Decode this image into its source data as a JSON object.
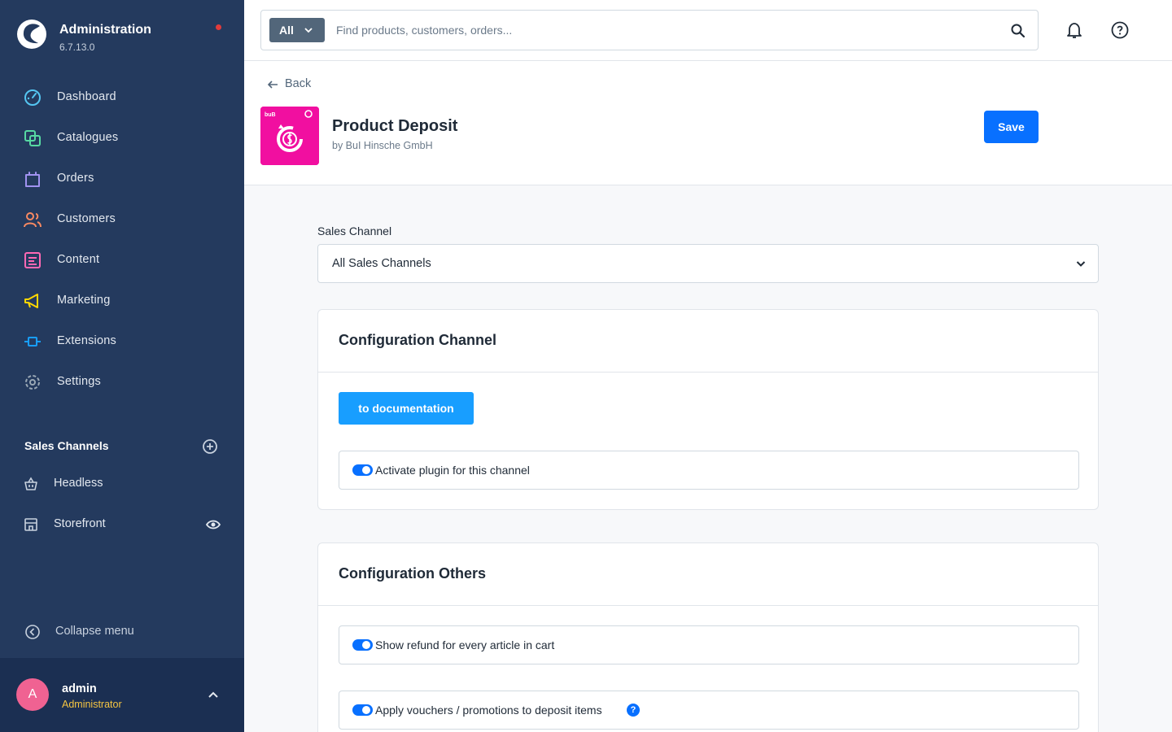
{
  "app": {
    "title": "Administration",
    "version": "6.7.13.0"
  },
  "nav": {
    "items": [
      {
        "label": "Dashboard",
        "icon": "dashboard-icon",
        "color": "#55c6f2"
      },
      {
        "label": "Catalogues",
        "icon": "catalogue-icon",
        "color": "#57d9a3"
      },
      {
        "label": "Orders",
        "icon": "orders-icon",
        "color": "#a092f0"
      },
      {
        "label": "Customers",
        "icon": "customers-icon",
        "color": "#f88962"
      },
      {
        "label": "Content",
        "icon": "content-icon",
        "color": "#ff68b4"
      },
      {
        "label": "Marketing",
        "icon": "marketing-icon",
        "color": "#ffd700"
      },
      {
        "label": "Extensions",
        "icon": "extensions-icon",
        "color": "#189eff"
      },
      {
        "label": "Settings",
        "icon": "settings-icon",
        "color": "#9aa8b5"
      }
    ]
  },
  "sales_channels": {
    "title": "Sales Channels",
    "items": [
      {
        "label": "Headless",
        "icon": "basket-icon"
      },
      {
        "label": "Storefront",
        "icon": "storefront-icon"
      }
    ]
  },
  "sidebar_footer": {
    "collapse_label": "Collapse menu"
  },
  "user": {
    "initial": "A",
    "name": "admin",
    "role": "Administrator"
  },
  "search": {
    "type_label": "All",
    "placeholder": "Find products, customers, orders..."
  },
  "header": {
    "back_label": "Back",
    "plugin_name": "Product Deposit",
    "plugin_author": "by BuI Hinsche GmbH",
    "save_label": "Save"
  },
  "main": {
    "sales_channel_label": "Sales Channel",
    "sales_channel_value": "All Sales Channels",
    "card_channel": {
      "title": "Configuration Channel",
      "doc_button": "to documentation",
      "switches": [
        {
          "label": "Activate plugin for this channel",
          "checked": true
        }
      ]
    },
    "card_others": {
      "title": "Configuration Others",
      "switches": [
        {
          "label": "Show refund for every article in cart",
          "checked": true
        },
        {
          "label": "Apply vouchers / promotions to deposit items",
          "checked": true,
          "help": "?"
        }
      ]
    }
  },
  "colors": {
    "sidebar": "#243a5e",
    "primary": "#0870ff",
    "plugin_brand": "#f10fa0"
  }
}
